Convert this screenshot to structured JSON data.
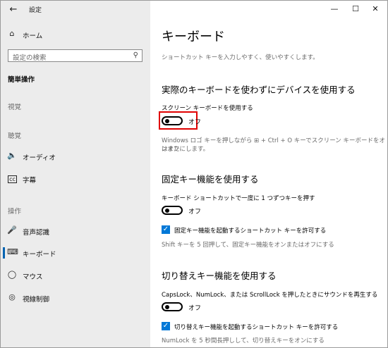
{
  "app": {
    "title": "設定"
  },
  "sidebar": {
    "home": "ホーム",
    "search_placeholder": "設定の検索",
    "category": "簡単操作",
    "sections": [
      "視覚",
      "聴覚",
      "操作"
    ],
    "items": [
      {
        "label": "オーディオ",
        "icon": "speaker-icon"
      },
      {
        "label": "字幕",
        "icon": "captions-icon"
      },
      {
        "label": "音声認識",
        "icon": "microphone-icon"
      },
      {
        "label": "キーボード",
        "icon": "keyboard-icon",
        "selected": true
      },
      {
        "label": "マウス",
        "icon": "mouse-icon"
      },
      {
        "label": "視線制御",
        "icon": "eye-icon"
      }
    ]
  },
  "main": {
    "title": "キーボード",
    "subtitle": "ショートカット キーを入力しやすく、使いやすくします。",
    "osk": {
      "heading": "実際のキーボードを使わずにデバイスを使用する",
      "label": "スクリーン キーボードを使用する",
      "toggle_state": "オフ",
      "description_line1": "Windows ロゴ キーを押しながら ⊞ + Ctrl + O キーでスクリーン キーボードをオンまた",
      "description_line2": "はオフにします。"
    },
    "sticky": {
      "heading": "固定キー機能を使用する",
      "label": "キーボード ショートカットで一度に 1 つずつキーを押す",
      "toggle_state": "オフ",
      "checkbox_label": "固定キー機能を起動するショートカット キーを許可する",
      "hint": "Shift キーを 5 回押して、固定キー機能をオンまたはオフにする"
    },
    "toggle_keys": {
      "heading": "切り替えキー機能を使用する",
      "label": "CapsLock、NumLock、または ScrollLock を押したときにサウンドを再生する",
      "toggle_state": "オフ",
      "checkbox_label": "切り替えキー機能を起動するショートカット キーを許可する",
      "hint": "NumLock を 5 秒間長押しして、切り替えキーをオンにする"
    }
  },
  "colors": {
    "accent": "#0078d7",
    "highlight": "#e00000",
    "sidebar_bg": "#ececec"
  }
}
